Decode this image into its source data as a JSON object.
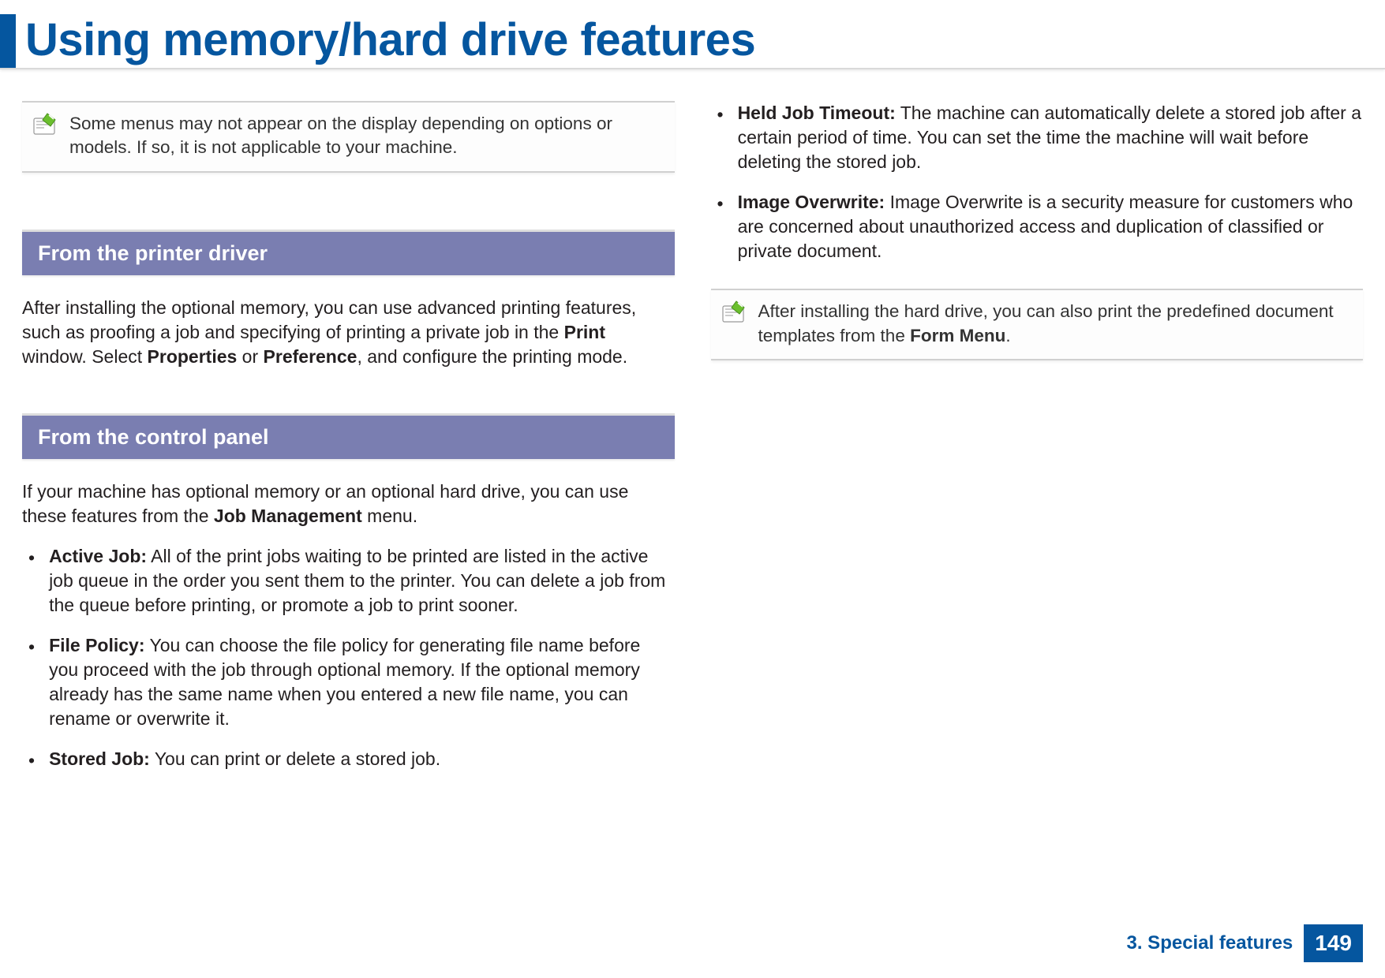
{
  "title": "Using memory/hard drive features",
  "note1": "Some menus may not appear on the display depending on options or models. If so, it is not applicable to your machine.",
  "section1": {
    "heading": "From the printer driver",
    "para_pre": "After installing the optional memory, you can use advanced printing features, such as proofing a job and specifying of printing a private job in the ",
    "para_b1": "Print",
    "para_mid1": " window. Select ",
    "para_b2": "Properties",
    "para_mid2": " or ",
    "para_b3": "Preference",
    "para_post": ", and configure the printing mode."
  },
  "section2": {
    "heading": "From the control panel",
    "intro_pre": "If your machine has optional memory or an optional hard drive, you can use these features from the ",
    "intro_b": "Job Management",
    "intro_post": " menu.",
    "items": [
      {
        "label": "Active Job:",
        "text": " All of the print jobs waiting to be printed are listed in the active job queue in the order you sent them to the printer. You can delete a job from the queue before printing, or promote a job to print sooner."
      },
      {
        "label": "File Policy:",
        "text": " You can choose the file policy for generating file name before you proceed with the job through optional memory. If the optional memory already has the same name when you entered a new file name, you can rename or overwrite it."
      },
      {
        "label": "Stored Job:",
        "text": " You can print or delete a stored job."
      },
      {
        "label": "Held Job Timeout:",
        "text": " The machine can automatically delete a stored job after a certain period of time. You can set the time the machine will wait before deleting the stored job."
      },
      {
        "label": "Image Overwrite:",
        "text": " Image Overwrite is a security measure for customers who are concerned about unauthorized access and duplication of classified or private document."
      }
    ]
  },
  "note2_pre": "After installing the hard drive, you can also print the predefined document templates from the ",
  "note2_b": "Form Menu",
  "note2_post": ".",
  "footer": {
    "chapter": "3. Special features",
    "page": "149"
  },
  "bullet": "•"
}
